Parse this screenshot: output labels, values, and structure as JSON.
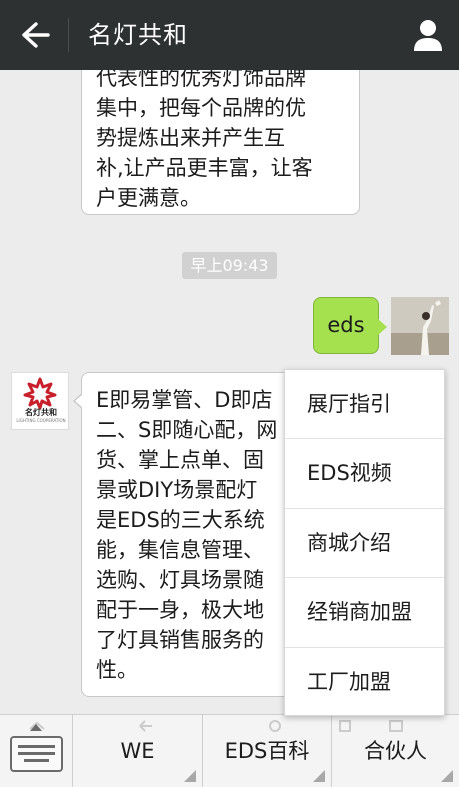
{
  "header": {
    "title": "名灯共和",
    "back_icon": "arrow-left-icon",
    "profile_icon": "person-icon"
  },
  "messages": {
    "msg1_lines": [
      "代表性的优秀灯饰品牌",
      "集中，把每个品牌的优",
      "势提炼出来并产生互",
      "补,让产品更丰富，让客",
      "户更满意。"
    ],
    "timestamp": "早上09:43",
    "outgoing_text": "eds",
    "brand_avatar_name": "名灯共和",
    "brand_avatar_sub": "LIGHTING COOPERATION",
    "msg2_lines": [
      "E即易掌管、D即店",
      "二、S即随心配，网",
      "货、掌上点单、固",
      "景或DIY场景配灯",
      "是EDS的三大系统",
      "能，集信息管理、",
      "选购、灯具场景随",
      "配于一身，极大地",
      "了灯具销售服务的",
      "性。"
    ]
  },
  "popup_menu": {
    "items": [
      "展厅指引",
      "EDS视频",
      "商城介绍",
      "经销商加盟",
      "工厂加盟"
    ]
  },
  "bottom_bar": {
    "keyboard_icon": "keyboard-icon",
    "tabs": [
      "WE",
      "EDS百科",
      "合伙人"
    ]
  },
  "colors": {
    "topbar": "#2e3132",
    "outgoing_bubble": "#a5e04f",
    "background": "#ececec"
  }
}
